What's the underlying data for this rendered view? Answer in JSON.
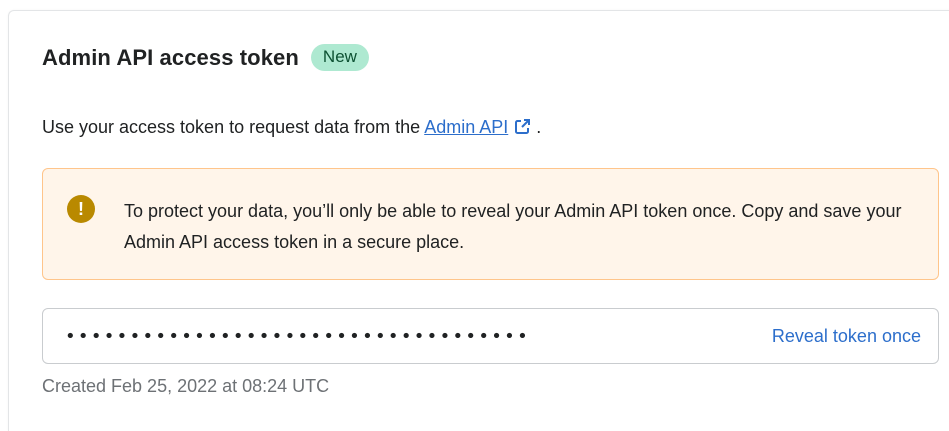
{
  "card": {
    "title": "Admin API access token",
    "badge": "New",
    "description_prefix": "Use your access token to request data from the ",
    "link_label": "Admin API",
    "description_suffix": " .",
    "warning_icon": "exclamation-icon",
    "warning_text": "To protect your data, you’ll only be able to reveal your Admin API token once. Copy and save your Admin API access token in a secure place.",
    "token_masked": "••••••••••••••••••••••••••••••••••••",
    "reveal_label": "Reveal token once",
    "created_text": "Created Feb 25, 2022 at 08:24 UTC"
  },
  "colors": {
    "badge_bg": "#aee9d1",
    "link": "#2c6ecb",
    "warning_bg": "#fff5ea",
    "warning_border": "#ffc58b",
    "warning_icon": "#b98900"
  }
}
